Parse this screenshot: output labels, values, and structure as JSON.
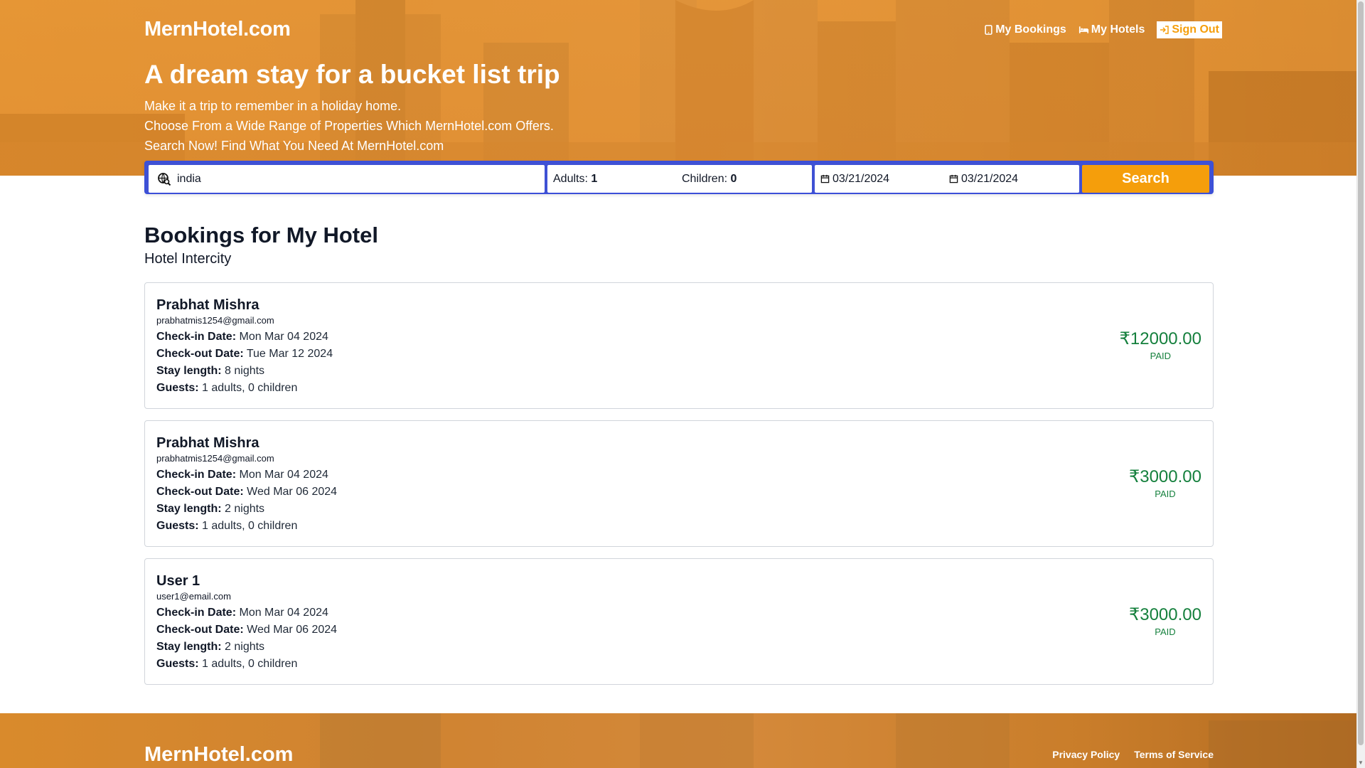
{
  "header": {
    "logo": "MernHotel.com",
    "nav": {
      "my_bookings": "My Bookings",
      "my_hotels": "My Hotels",
      "sign_out": "Sign Out"
    }
  },
  "hero": {
    "title": "A dream stay for a bucket list trip",
    "lines": [
      "Make it a trip to remember in a holiday home.",
      "Choose From a Wide Range of Properties Which MernHotel.com Offers.",
      "Search Now! Find What You Need At MernHotel.com"
    ]
  },
  "search": {
    "destination_value": "india",
    "adults_label": "Adults:",
    "adults_value": "1",
    "children_label": "Children:",
    "children_value": "0",
    "check_in": "03/21/2024",
    "check_out": "03/21/2024",
    "button_label": "Search"
  },
  "main": {
    "heading": "Bookings for My Hotel",
    "hotel_name": "Hotel Intercity",
    "labels": {
      "check_in": "Check-in Date:",
      "check_out": "Check-out Date:",
      "stay_length": "Stay length:",
      "guests": "Guests:"
    },
    "bookings": [
      {
        "name": "Prabhat Mishra",
        "email": "prabhatmis1254@gmail.com",
        "check_in": "Mon Mar 04 2024",
        "check_out": "Tue Mar 12 2024",
        "stay_length": "8 nights",
        "guests": "1 adults, 0 children",
        "amount": "₹12000.00",
        "status": "PAID"
      },
      {
        "name": "Prabhat Mishra",
        "email": "prabhatmis1254@gmail.com",
        "check_in": "Mon Mar 04 2024",
        "check_out": "Wed Mar 06 2024",
        "stay_length": "2 nights",
        "guests": "1 adults, 0 children",
        "amount": "₹3000.00",
        "status": "PAID"
      },
      {
        "name": "User 1",
        "email": "user1@email.com",
        "check_in": "Mon Mar 04 2024",
        "check_out": "Wed Mar 06 2024",
        "stay_length": "2 nights",
        "guests": "1 adults, 0 children",
        "amount": "₹3000.00",
        "status": "PAID"
      }
    ]
  },
  "footer": {
    "logo": "MernHotel.com",
    "privacy": "Privacy Policy",
    "terms": "Terms of Service"
  },
  "colors": {
    "accent_orange": "#f59e0b",
    "search_border_blue": "#3f51d4",
    "paid_green": "#15803d"
  }
}
